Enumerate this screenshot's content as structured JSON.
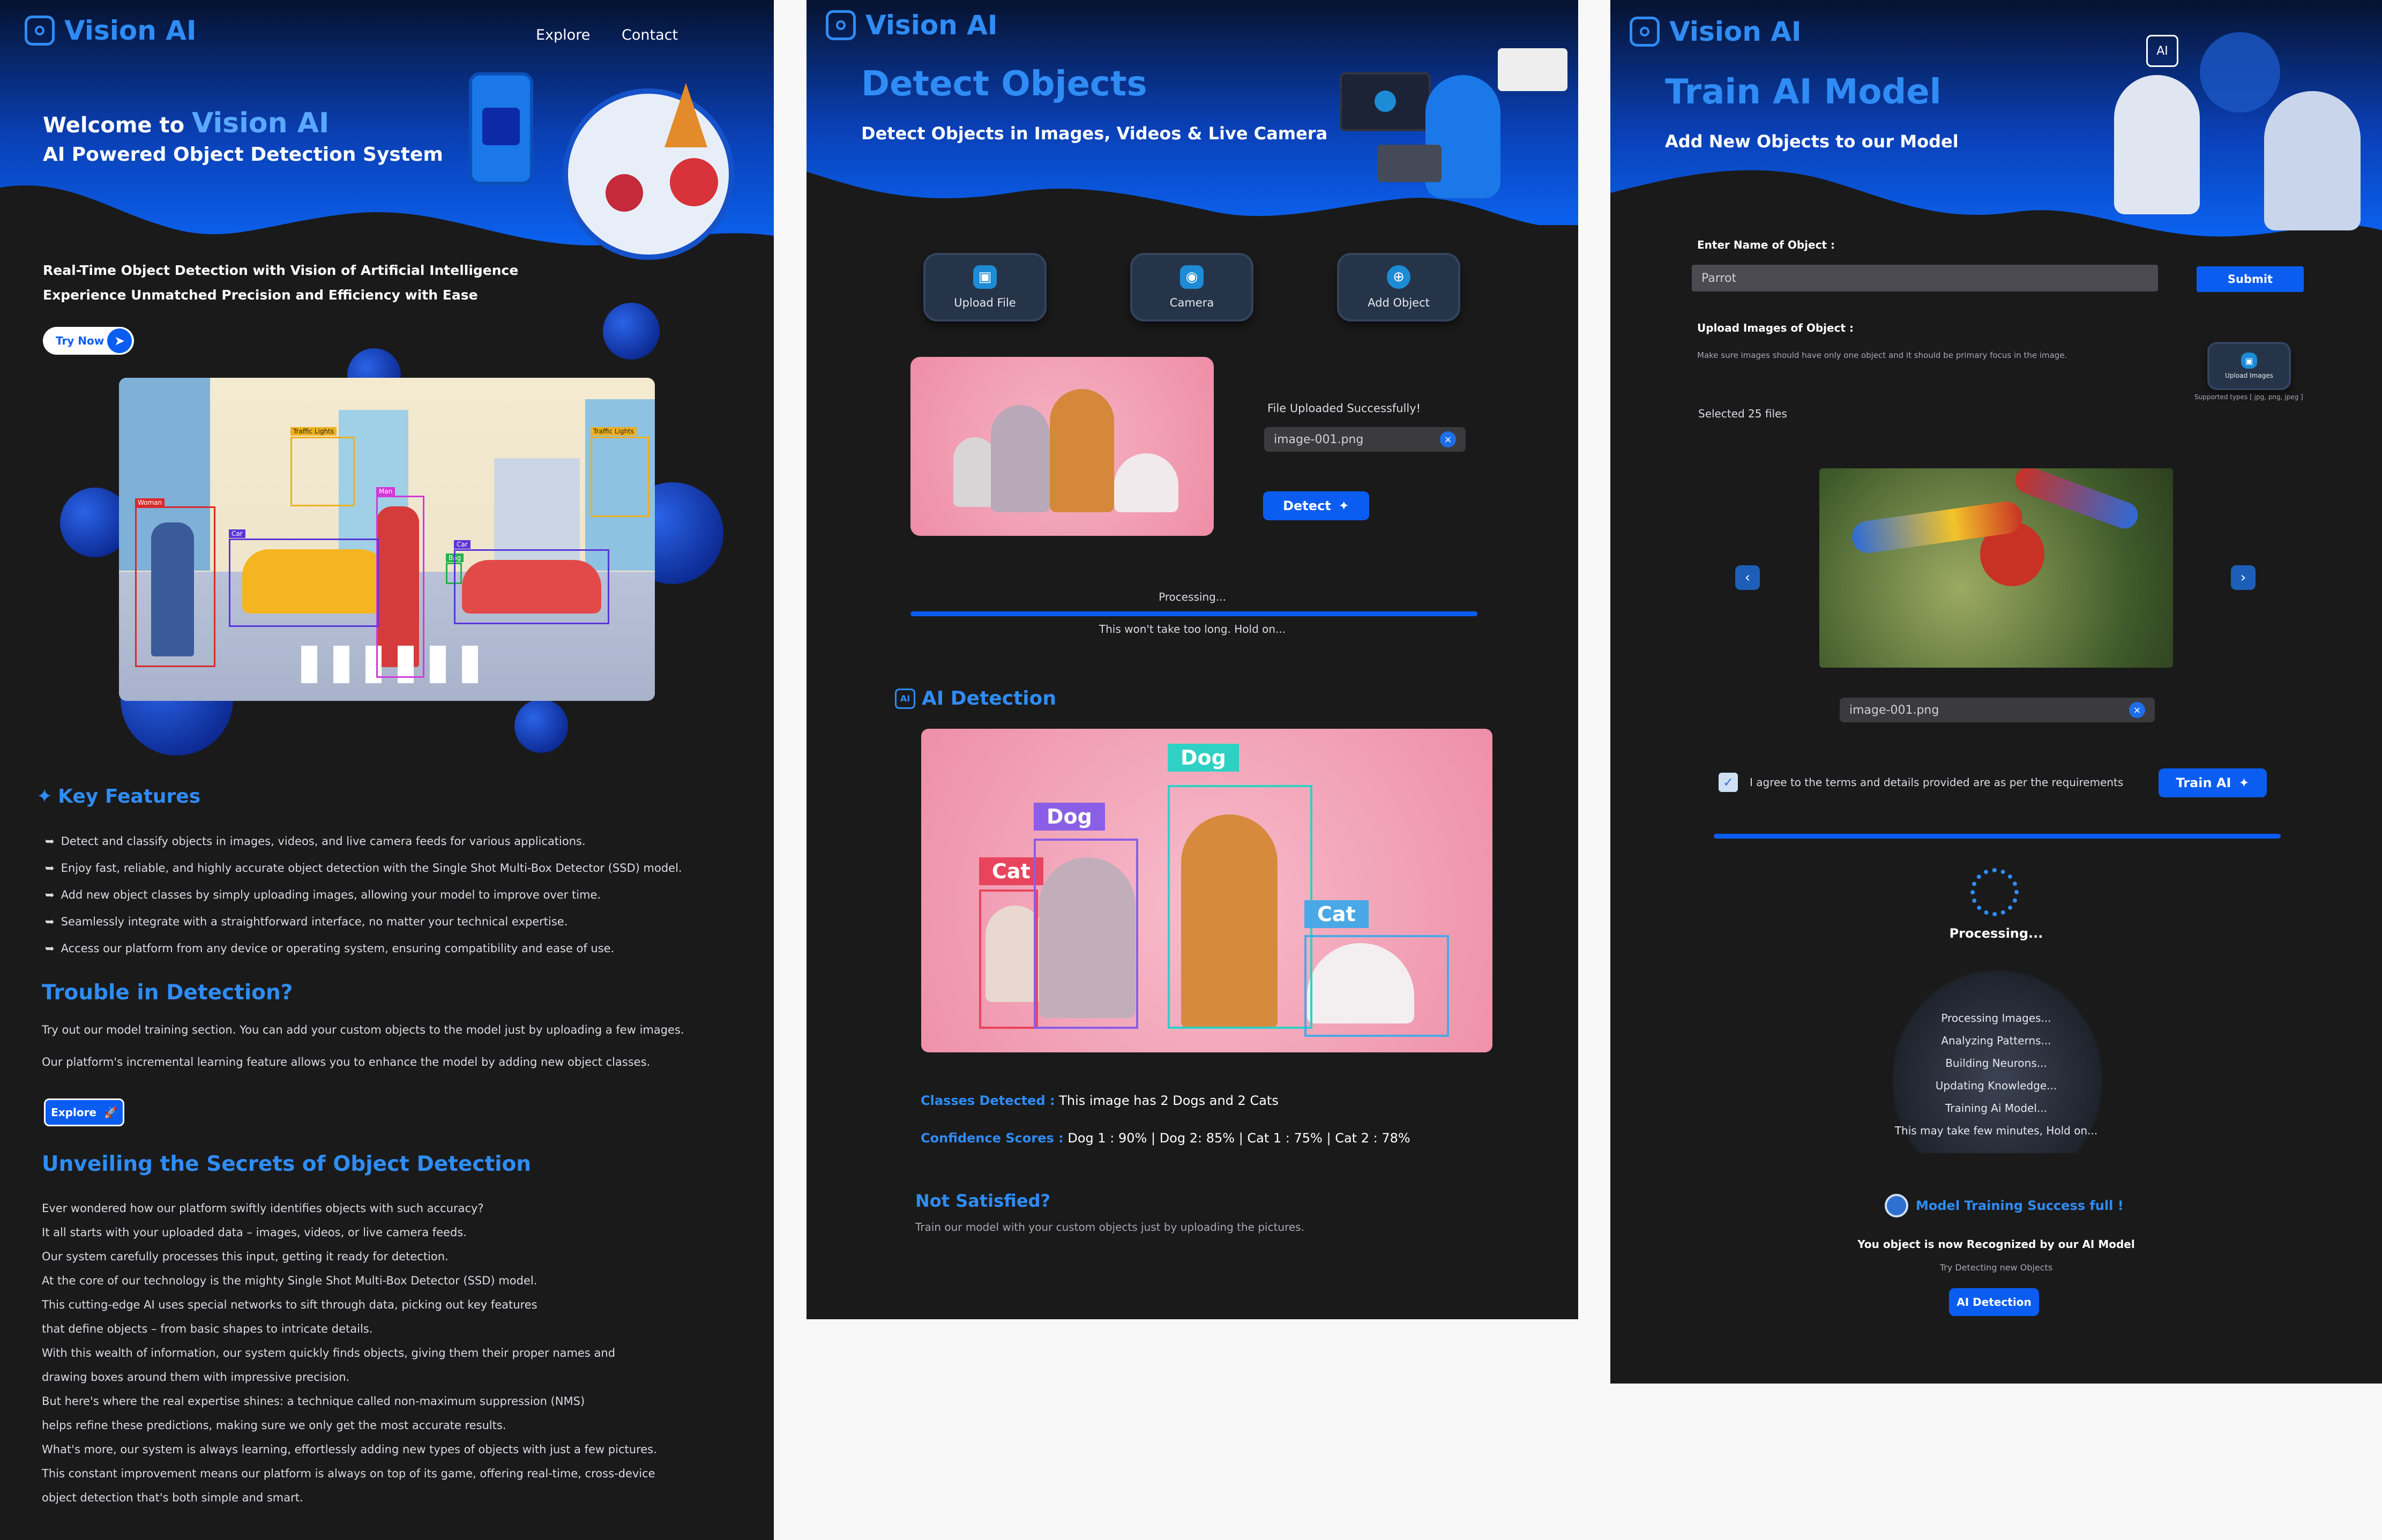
{
  "brand": {
    "name": "Vision AI",
    "accent": "#2f8cf5",
    "button_blue": "#0a5df0"
  },
  "home": {
    "nav": {
      "explore": "Explore",
      "contact": "Contact"
    },
    "hero": {
      "welcome_prefix": "Welcome to",
      "welcome_brand": "Vision AI",
      "subtitle": "AI Powered Object Detection System",
      "line1": "Real-Time Object Detection with Vision of Artificial Intelligence",
      "line2": "Experience Unmatched Precision and Efficiency with Ease",
      "try_now": "Try Now"
    },
    "scene_labels": [
      "Woman",
      "Traffic Lights",
      "Man",
      "Car",
      "Bag",
      "Car",
      "Traffic Lights"
    ],
    "features": {
      "title": "Key Features",
      "items": [
        "Detect and classify objects in images, videos, and live camera feeds for various applications.",
        "Enjoy fast, reliable, and highly accurate object detection with the Single Shot Multi-Box Detector (SSD) model.",
        "Add new object classes by simply uploading images, allowing your model to improve over time.",
        "Seamlessly integrate with a straightforward interface, no matter your technical expertise.",
        "Access our platform from any device or operating system, ensuring compatibility and ease of use."
      ]
    },
    "trouble": {
      "title": "Trouble in Detection?",
      "line1": "Try out our model training section. You can add your custom objects to the model just by uploading a few images.",
      "line2": "Our platform's incremental learning feature allows you to enhance the model by adding new object classes.",
      "explore": "Explore"
    },
    "secrets": {
      "title": "Unveiling the Secrets of Object Detection",
      "lines": [
        "Ever wondered how our platform swiftly identifies objects with such accuracy?",
        "It all starts with your uploaded data – images, videos, or live camera feeds.",
        "Our system carefully processes this input, getting it ready for detection.",
        "At the core of our technology is the mighty Single Shot Multi-Box Detector (SSD) model.",
        "This cutting-edge AI uses special networks to sift through data, picking out key features",
        "that define objects – from basic shapes to intricate details.",
        "With this wealth of information, our system quickly finds objects, giving them their proper names and",
        "drawing boxes around them with impressive precision.",
        "But here's where the real expertise shines: a technique called non-maximum suppression (NMS)",
        "helps refine these predictions, making sure we only get the most accurate results.",
        "What's more, our system is always learning, effortlessly adding new types of objects with just a few pictures.",
        "This constant improvement means our platform is always on top of its game, offering real-time, cross-device",
        "object detection that's both simple and smart."
      ]
    }
  },
  "detect": {
    "title": "Detect Objects",
    "subtitle": "Detect Objects in Images, Videos & Live Camera",
    "tiles": [
      "Upload File",
      "Camera",
      "Add Object"
    ],
    "upload_status": "File Uploaded Successfully!",
    "file_name": "image-001.png",
    "detect_button": "Detect",
    "processing": "Processing...",
    "processing_hint": "This won't take too long. Hold on...",
    "progress": 1.0,
    "ai_title": "AI Detection",
    "labels": [
      "Cat",
      "Dog",
      "Dog",
      "Cat"
    ],
    "classes_label": "Classes Detected :",
    "classes_value": "This image has 2 Dogs and  2 Cats",
    "confidence_label": "Confidence Scores :",
    "confidence_value": "Dog 1 : 90% | Dog 2: 85% | Cat 1 : 75% | Cat 2 : 78%",
    "not_satisfied": "Not Satisfied?",
    "not_satisfied_hint": "Train our model with your custom objects just by uploading the pictures."
  },
  "train": {
    "title": "Train AI Model",
    "subtitle": "Add New Objects to our Model",
    "name_label": "Enter Name of Object :",
    "name_value": "Parrot",
    "submit": "Submit",
    "upload_label": "Upload Images of Object :",
    "upload_hint": "Make sure images should have only one object and it should be primary focus in the image.",
    "upload_button": "Upload Images",
    "supported": "Supported types [ jpg, png, jpeg ]",
    "selected": "Selected 25 files",
    "file_name": "image-001.png",
    "agree": "I agree to the terms and details provided are as per the requirements",
    "train_button": "Train AI",
    "progress": 1.0,
    "processing": "Processing...",
    "steps": [
      "Processing Images...",
      "Analyzing Patterns...",
      "Building Neurons...",
      "Updating Knowledge...",
      "Training Ai Model...",
      "This may take few minutes, Hold on..."
    ],
    "success": "Model Training Success full !",
    "recognized": "You object is now Recognized by our AI Model",
    "try_new": "Try Detecting new Objects",
    "ai_detection": "AI Detection"
  }
}
